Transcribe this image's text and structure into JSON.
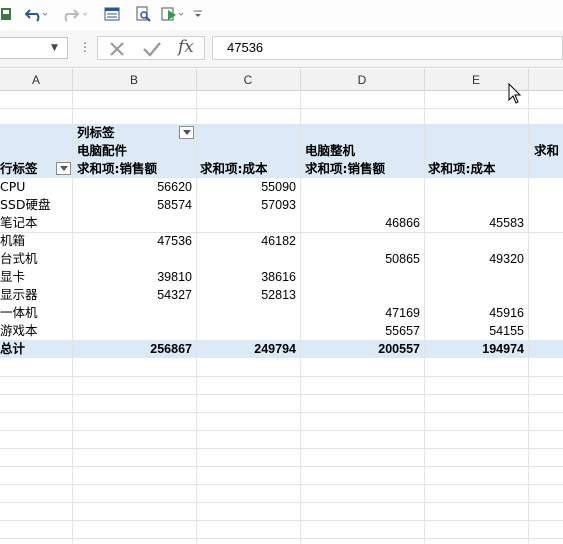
{
  "formula_bar": {
    "value": "47536"
  },
  "columns": [
    "A",
    "B",
    "C",
    "D",
    "E"
  ],
  "pivot": {
    "col_label_caption": "列标签",
    "row_label_caption": "行标签",
    "group1_name": "电脑配件",
    "group2_name": "电脑整机",
    "measure_sales": "求和项:销售额",
    "measure_cost": "求和项:成本",
    "measure_partial": "求和",
    "rows": [
      {
        "label": "CPU",
        "b": "56620",
        "c": "55090",
        "d": "",
        "e": ""
      },
      {
        "label": "SSD硬盘",
        "b": "58574",
        "c": "57093",
        "d": "",
        "e": ""
      },
      {
        "label": "笔记本",
        "b": "",
        "c": "",
        "d": "46866",
        "e": "45583"
      },
      {
        "label": "机箱",
        "b": "47536",
        "c": "46182",
        "d": "",
        "e": ""
      },
      {
        "label": "台式机",
        "b": "",
        "c": "",
        "d": "50865",
        "e": "49320"
      },
      {
        "label": "显卡",
        "b": "39810",
        "c": "38616",
        "d": "",
        "e": ""
      },
      {
        "label": "显示器",
        "b": "54327",
        "c": "52813",
        "d": "",
        "e": ""
      },
      {
        "label": "一体机",
        "b": "",
        "c": "",
        "d": "47169",
        "e": "45916"
      },
      {
        "label": "游戏本",
        "b": "",
        "c": "",
        "d": "55657",
        "e": "54155"
      }
    ],
    "total": {
      "label": "总计",
      "b": "256867",
      "c": "249794",
      "d": "200557",
      "e": "194974"
    }
  },
  "colors": {
    "pivot_band": "#dce9f7",
    "accent": "#2b579a"
  },
  "icons": [
    "save-icon",
    "undo-icon",
    "redo-icon",
    "form-icon",
    "print-preview-icon",
    "run-icon",
    "customize-toolbar-icon",
    "cancel-icon",
    "enter-icon",
    "insert-function-icon",
    "filter-dropdown-icon",
    "mouse-cursor-icon"
  ]
}
